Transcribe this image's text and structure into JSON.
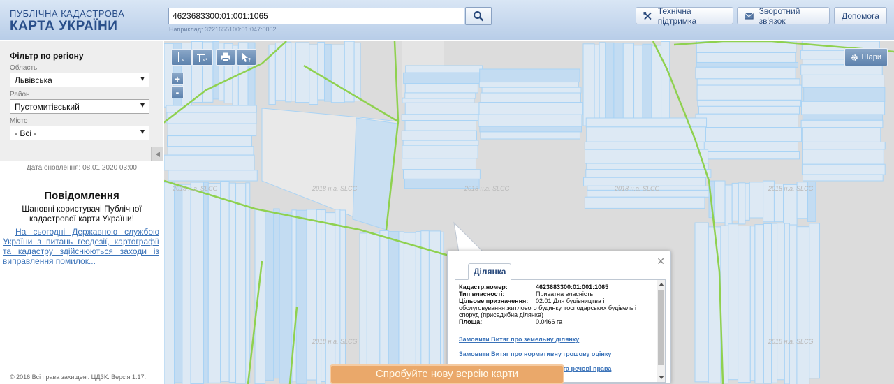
{
  "header": {
    "logo_line1": "ПУБЛІЧНА КАДАСТРОВА",
    "logo_line2": "КАРТА УКРАЇНИ",
    "search_value": "4623683300:01:001:1065",
    "search_hint": "Наприклад: 3221655100:01:047:0052",
    "support_label": "Технічна підтримка",
    "feedback_label": "Зворотний зв'язок",
    "help_label": "Допомога"
  },
  "sidebar": {
    "filter_title": "Фільтр по регіону",
    "region_label": "Область",
    "region_value": "Львівська",
    "district_label": "Район",
    "district_value": "Пустомитівський",
    "city_label": "Місто",
    "city_value": "- Всі -",
    "update_text": "Дата оновлення: 08.01.2020 03:00",
    "notice_title": "Повідомлення",
    "notice_text": "Шановні користувачі Публічної кадастрової карти України!",
    "notice_link": "На сьогодні Державною службою України з питань геодезії, картографії та кадастру здійснюються заходи із виправлення помилок...",
    "copyright": "© 2016 Всі права захищені. ЦДЗК. Версія 1.17."
  },
  "map": {
    "layers_label": "Шари",
    "watermark": "2018 н.а. SLCG",
    "banner": "Спробуйте нову версію карти",
    "parcel_color": "#a9d3f5",
    "road_color": "#8fd14f"
  },
  "popup": {
    "tab_label": "Ділянка",
    "cadastre_label": "Кадастр.номер:",
    "cadastre_value": "4623683300:01:001:1065",
    "ownership_label": "Тип власності:",
    "ownership_value": "Приватна власність",
    "purpose_label": "Цільове призначення:",
    "purpose_value_1": "02.01 Для будівництва і",
    "purpose_value_2": "обслуговування житлового будинку, господарських будівель і споруд (присадибна ділянка)",
    "area_label": "Площа:",
    "area_value": "0.0466 га",
    "link_1": "Замовити Витяг про земельну ділянку",
    "link_2": "Замовити Витяг про нормативну грошову оцінку",
    "link_3": "Інформація про право власності та речові права"
  }
}
